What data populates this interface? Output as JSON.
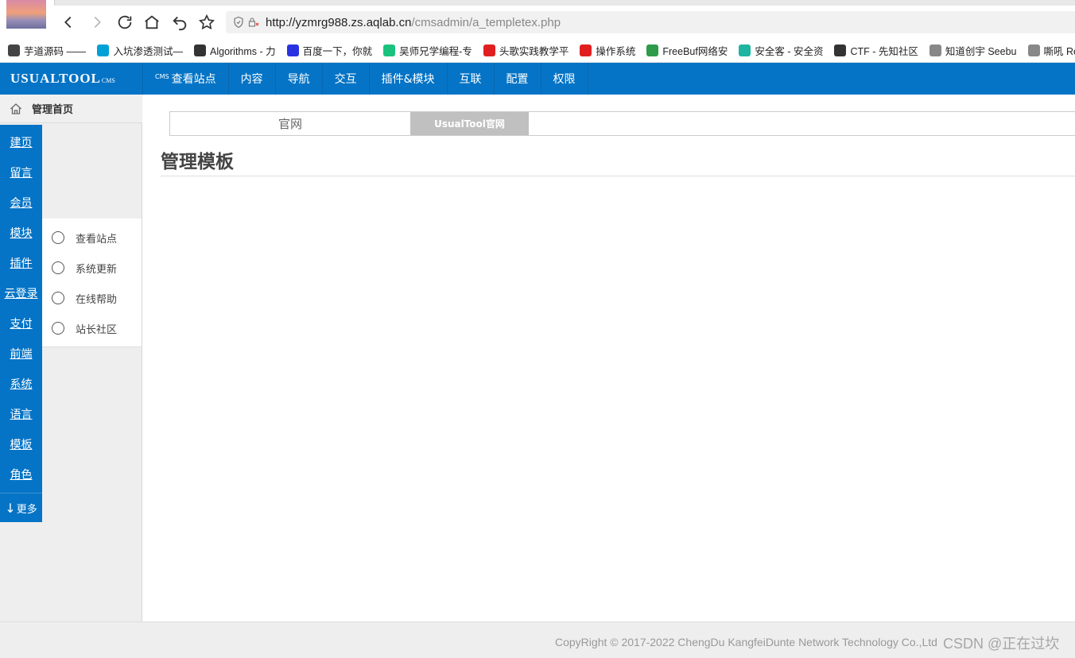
{
  "browser": {
    "url_host": "http://yzmrg988.zs.aqlab.cn",
    "url_path": "/cmsadmin/a_templetex.php"
  },
  "bookmarks": [
    {
      "label": "芋道源码 ——",
      "icon": "bookmark-icon-yudao",
      "color": "#444444"
    },
    {
      "label": "入坑渗透测试—",
      "icon": "bilibili-icon",
      "color": "#00a1d6"
    },
    {
      "label": "Algorithms - 力",
      "icon": "leetcode-icon",
      "color": "#333333"
    },
    {
      "label": "百度一下，你就",
      "icon": "baidu-paw-icon",
      "color": "#2932e1"
    },
    {
      "label": "吴师兄学编程-专",
      "icon": "shield-bookmark-icon",
      "color": "#19c37d"
    },
    {
      "label": "头歌实践教学平",
      "icon": "touge-icon",
      "color": "#e02020"
    },
    {
      "label": "操作系统",
      "icon": "touge-icon",
      "color": "#e02020"
    },
    {
      "label": "FreeBuf网络安",
      "icon": "freebuf-icon",
      "color": "#2e9b4a"
    },
    {
      "label": "安全客 - 安全资",
      "icon": "anquanke-icon",
      "color": "#1fb5a0"
    },
    {
      "label": "CTF - 先知社区",
      "icon": "xianzhi-icon",
      "color": "#333333"
    },
    {
      "label": "知道创宇 Seebu",
      "icon": "page-icon",
      "color": "#888888"
    },
    {
      "label": "嘶吼 RoarTa",
      "icon": "page-icon",
      "color": "#888888"
    }
  ],
  "header": {
    "logo_main": "USUALTOOL",
    "logo_sub": "CMS",
    "nav": [
      {
        "sup": "CMS",
        "label": "查看站点"
      },
      {
        "label": "内容"
      },
      {
        "label": "导航"
      },
      {
        "label": "交互"
      },
      {
        "label": "插件&模块"
      },
      {
        "label": "互联"
      },
      {
        "label": "配置"
      },
      {
        "label": "权限"
      }
    ]
  },
  "sidebar": {
    "home_label": "管理首页",
    "rail": [
      "建页",
      "留言",
      "会员",
      "模块",
      "插件",
      "云登录",
      "支付",
      "前端",
      "系统",
      "语言",
      "模板",
      "角色"
    ],
    "more_arrow": "↓",
    "more_label": "更多",
    "submenu": [
      "查看站点",
      "系统更新",
      "在线帮助",
      "站长社区"
    ]
  },
  "main": {
    "tabs": [
      {
        "label": "官网",
        "active": false
      },
      {
        "label": "UsualTool官网",
        "active": true
      }
    ],
    "page_title": "管理模板"
  },
  "footer": {
    "copyright": "CopyRight © 2017-2022 ChengDu KangfeiDunte Network Technology Co.,Ltd",
    "watermark": "CSDN @正在过坎"
  },
  "colors": {
    "brand_blue": "#0574c6",
    "active_tab": "#c0c0c0",
    "footer_bg": "#eeeeee"
  }
}
